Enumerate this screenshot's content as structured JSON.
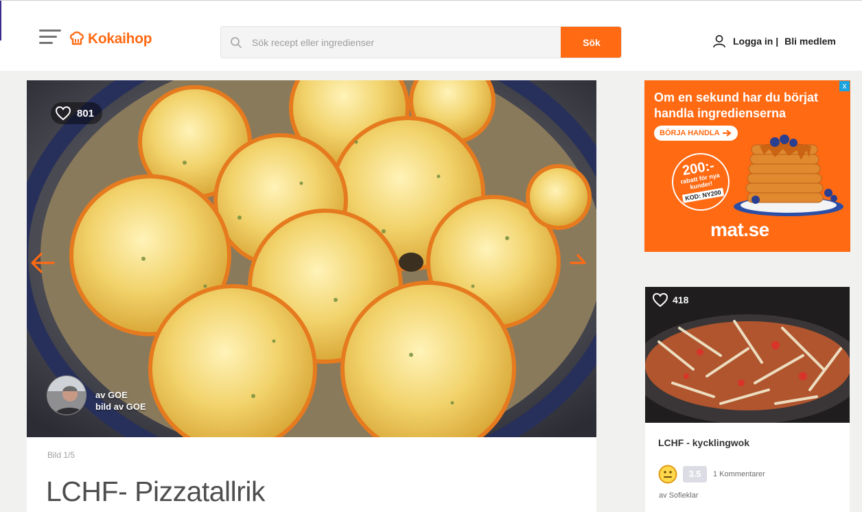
{
  "header": {
    "logo_text": "Kokaihop",
    "search_placeholder": "Sök recept eller ingredienser",
    "search_button": "Sök",
    "login_label": "Logga in |",
    "signup_label": "Bli medlem"
  },
  "recipe": {
    "likes": "801",
    "author_line": "av GOE",
    "photo_line": "bild av GOE",
    "image_counter": "Bild 1/5",
    "title": "LCHF- Pizzatallrik"
  },
  "ad": {
    "headline": "Om en sekund har du börjat handla ingredienserna",
    "cta": "BÖRJA HANDLA",
    "offer_amount": "200:-",
    "offer_text": "rabatt för nya kunder!",
    "offer_code": "KOD: NY200",
    "brand": "mat.se",
    "close_label": "x"
  },
  "side_recipe": {
    "likes": "418",
    "title": "LCHF - kycklingwok",
    "rating": "3.5",
    "comments": "1 Kommentarer",
    "author": "av Sofieklar"
  },
  "colors": {
    "brand_orange": "#ff6a13",
    "background": "#f1f1f0"
  }
}
